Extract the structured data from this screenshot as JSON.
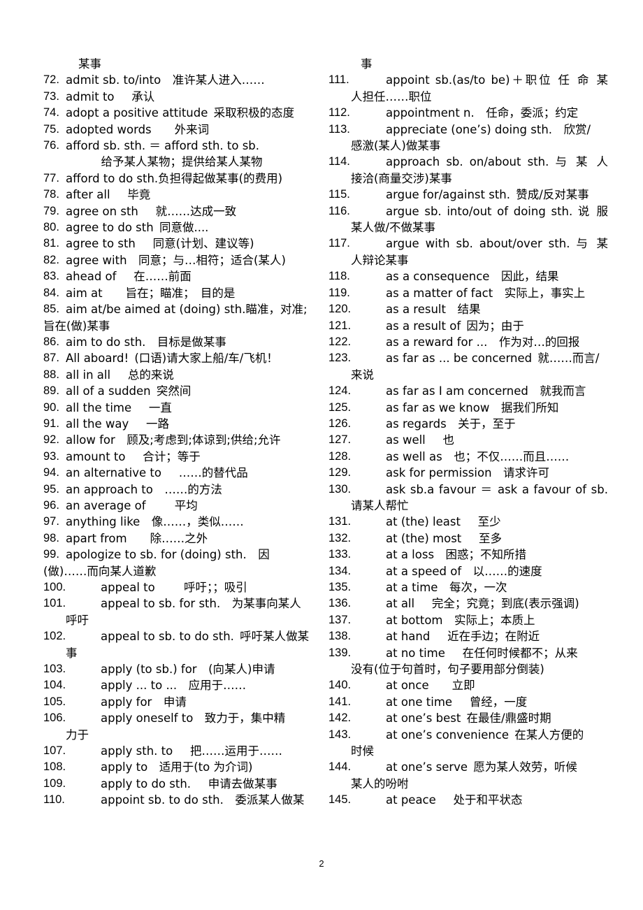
{
  "document": {
    "page_number": "2",
    "layout": "two-column",
    "left_column": {
      "continuation_text": "某事",
      "entries": [
        {
          "num": "72.",
          "line1": "admit sb. to/into 准许某人进入……"
        },
        {
          "num": "73.",
          "line1": "admit to  承认"
        },
        {
          "num": "74.",
          "line1": "adopt a positive attitude 采取积极的态度"
        },
        {
          "num": "75.",
          "line1": "adopted words  外来词"
        },
        {
          "num": "76.",
          "line1": "afford sb. sth. ＝ afford sth. to sb.",
          "line2": "　　　　　给予某人某物；提供给某人某物"
        },
        {
          "num": "77.",
          "line1": "afford to do sth.负担得起做某事(的费用)"
        },
        {
          "num": "78.",
          "line1": "after all  毕竟"
        },
        {
          "num": "79.",
          "line1": "agree on sth  就……达成一致"
        },
        {
          "num": "80.",
          "line1": "agree to do sth 同意做...."
        },
        {
          "num": "81.",
          "line1": "agree to sth  同意(计划、建议等)"
        },
        {
          "num": "82.",
          "line1": "agree with 同意；与…相符；适合(某人)"
        },
        {
          "num": "83.",
          "line1": "ahead of  在……前面"
        },
        {
          "num": "84.",
          "line1": "aim at  旨在；瞄准； 目的是"
        },
        {
          "num": "85.",
          "line1": "aim at/be aimed at (doing) sth.瞄准，对准;",
          "line2": "旨在(做)某事"
        },
        {
          "num": "86.",
          "line1": "aim to do sth. 目标是做某事"
        },
        {
          "num": "87.",
          "line1": "All aboard! (口语)请大家上船/车/飞机！"
        },
        {
          "num": "88.",
          "line1": "all in all  总的来说"
        },
        {
          "num": "89.",
          "line1": "all of a sudden 突然间"
        },
        {
          "num": "90.",
          "line1": "all the time  一直"
        },
        {
          "num": "91.",
          "line1": "all the way  一路"
        },
        {
          "num": "92.",
          "line1": "allow for  顾及;考虑到;体谅到;供给;允许"
        },
        {
          "num": "93.",
          "line1": "amount to  合计；等于"
        },
        {
          "num": "94.",
          "line1": "an alternative to  ……的替代品"
        },
        {
          "num": "95.",
          "line1": "an approach to ……的方法"
        },
        {
          "num": "96.",
          "line1": "an average of   平均"
        },
        {
          "num": "97.",
          "line1": "anything like 像……，类似……"
        },
        {
          "num": "98.",
          "line1": "apart from  除……之外"
        },
        {
          "num": "99.",
          "line1": "apologize to sb. for (doing) sth. 因",
          "line2": "(做)……而向某人道歉"
        },
        {
          "num": "100.",
          "line1": "appeal to   呼吁；；吸引",
          "wide": true
        },
        {
          "num": "101.",
          "line1": "appeal to sb. for sth. 为某事向某人",
          "line2": "呼吁",
          "wide": true
        },
        {
          "num": "102.",
          "line1": "appeal to sb. to do sth. 呼吁某人做某",
          "line2": "事",
          "wide": true
        },
        {
          "num": "103.",
          "line1": "apply (to sb.) for  (向某人)申请",
          "wide": true
        },
        {
          "num": "104.",
          "line1": "apply ... to ...  应用于……",
          "wide": true
        },
        {
          "num": "105.",
          "line1": "apply for  申请",
          "wide": true
        },
        {
          "num": "106.",
          "line1": "apply oneself to 致力于，集中精",
          "line2": "力于",
          "wide": true
        },
        {
          "num": "107.",
          "line1": "apply sth. to  把……运用于……",
          "wide": true
        },
        {
          "num": "108.",
          "line1": "apply to 适用于(to 为介词)",
          "wide": true
        },
        {
          "num": "109.",
          "line1": "apply to do sth.  申请去做某事",
          "wide": true
        },
        {
          "num": "110.",
          "line1": "appoint sb. to do sth.  委派某人做某",
          "wide": true
        }
      ]
    },
    "right_column": {
      "continuation_text": "事",
      "entries": [
        {
          "num": "111.",
          "line1": "appoint sb.(as/to be)＋职位 任 命 某",
          "line2": "人担任……职位",
          "justify1": true
        },
        {
          "num": "112.",
          "line1": "appointment n.  任命，委派；约定"
        },
        {
          "num": "113.",
          "line1": "appreciate (one’s) doing sth. 欣赏/",
          "line2": "感激(某人)做某事"
        },
        {
          "num": "114.",
          "line1": "approach sb. on/about sth. 与 某 人",
          "line2": "接洽(商量交涉)某事",
          "justify1": true
        },
        {
          "num": "115.",
          "line1": "argue for/against sth. 赞成/反对某事"
        },
        {
          "num": "116.",
          "line1": "argue sb. into/out of doing sth. 说 服",
          "line2": "某人做/不做某事",
          "justify1": true
        },
        {
          "num": "117.",
          "line1": "argue with sb. about/over sth. 与 某",
          "line2": "人辩论某事",
          "justify1": true
        },
        {
          "num": "118.",
          "line1": "as a consequence 因此，结果"
        },
        {
          "num": "119.",
          "line1": "as a matter of fact  实际上，事实上"
        },
        {
          "num": "120.",
          "line1": "as a result  结果"
        },
        {
          "num": "121.",
          "line1": "as a result of 因为；由于"
        },
        {
          "num": "122.",
          "line1": "as a reward for ... 作为对…的回报"
        },
        {
          "num": "123.",
          "line1": "as far as ... be concerned 就……而言/",
          "line2": "来说"
        },
        {
          "num": "124.",
          "line1": "as far as I am concerned  就我而言"
        },
        {
          "num": "125.",
          "line1": "as far as we know  据我们所知"
        },
        {
          "num": "126.",
          "line1": "as regards  关于，至于"
        },
        {
          "num": "127.",
          "line1": "as well  也"
        },
        {
          "num": "128.",
          "line1": "as well as 也；不仅……而且……"
        },
        {
          "num": "129.",
          "line1": "ask for permission  请求许可"
        },
        {
          "num": "130.",
          "line1": "ask sb.a favour ＝ ask a favour of sb.",
          "line2": "请某人帮忙",
          "justify1": true
        },
        {
          "num": "131.",
          "line1": "at (the) least  至少"
        },
        {
          "num": "132.",
          "line1": "at (the) most  至多"
        },
        {
          "num": "133.",
          "line1": "at a loss 困惑；不知所措"
        },
        {
          "num": "134.",
          "line1": "at a speed of 以……的速度"
        },
        {
          "num": "135.",
          "line1": "at a time 每次，一次"
        },
        {
          "num": "136.",
          "line1": "at all  完全；究竟；到底(表示强调)"
        },
        {
          "num": "137.",
          "line1": "at bottom 实际上；本质上"
        },
        {
          "num": "138.",
          "line1": "at hand  近在手边；在附近"
        },
        {
          "num": "139.",
          "line1": "at no time  在任何时候都不；从来",
          "line2": "没有(位于句首时，句子要用部分倒装)"
        },
        {
          "num": "140.",
          "line1": "at once  立即"
        },
        {
          "num": "141.",
          "line1": "at one time  曾经，一度"
        },
        {
          "num": "142.",
          "line1": "at one’s best 在最佳/鼎盛时期"
        },
        {
          "num": "143.",
          "line1": "at one’s convenience 在某人方便的",
          "line2": "时候"
        },
        {
          "num": "144.",
          "line1": "at one’s serve 愿为某人效劳，听候",
          "line2": "某人的吩咐"
        },
        {
          "num": "145.",
          "line1": "at peace  处于和平状态"
        }
      ]
    }
  }
}
